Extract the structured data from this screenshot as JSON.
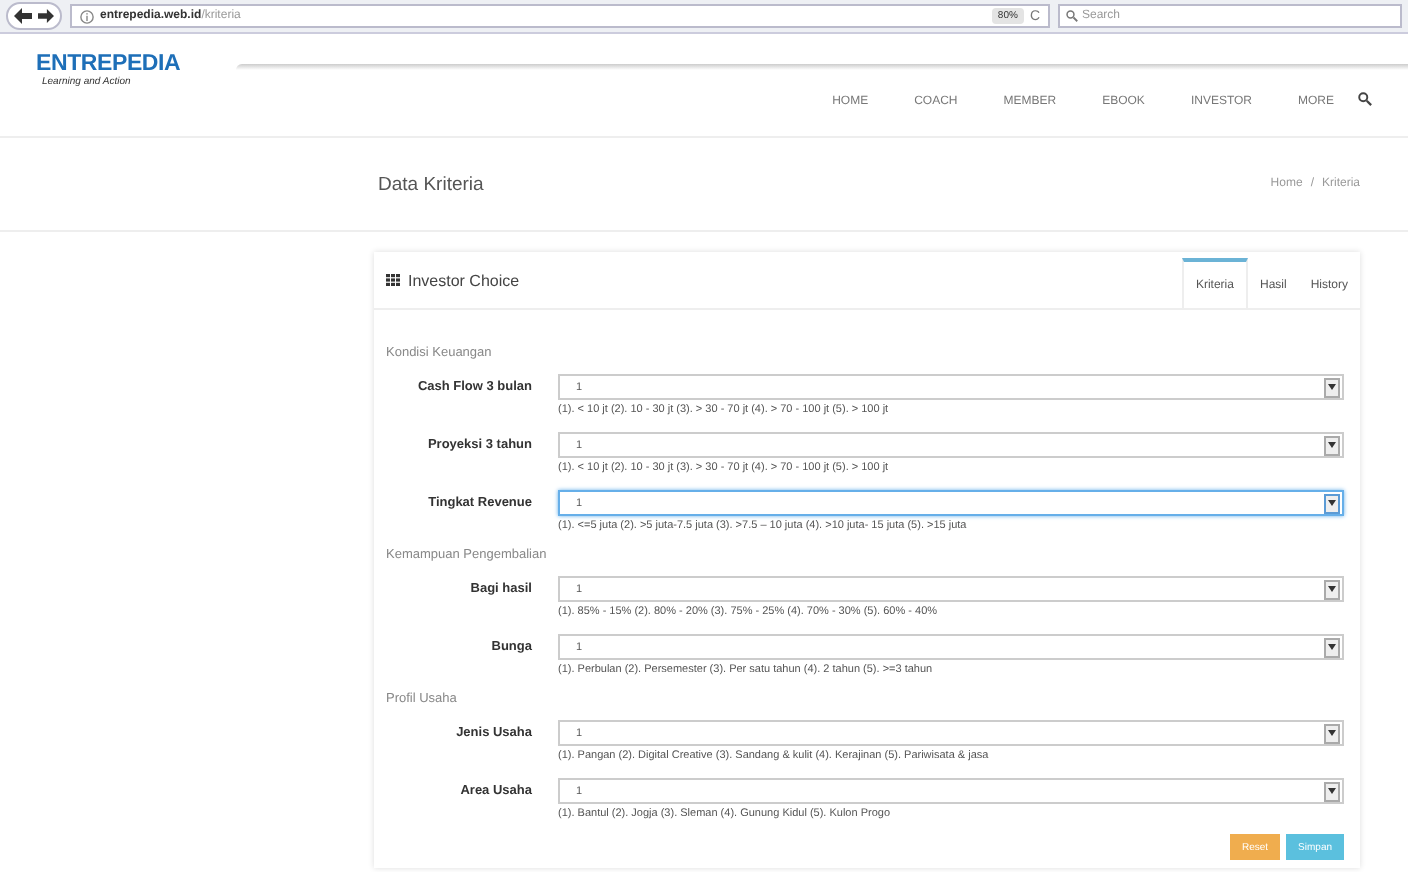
{
  "browser": {
    "url_host": "entrepedia.web.id",
    "url_path": "/kriteria",
    "zoom": "80%",
    "reload": "C",
    "search_placeholder": "Search"
  },
  "site": {
    "logo": "ENTREPEDIA",
    "tagline": "Learning and Action",
    "nav": [
      {
        "label": "HOME"
      },
      {
        "label": "COACH"
      },
      {
        "label": "MEMBER"
      },
      {
        "label": "EBOOK"
      },
      {
        "label": "INVESTOR"
      },
      {
        "label": "MORE"
      }
    ]
  },
  "page": {
    "title": "Data Kriteria",
    "breadcrumb": [
      "Home",
      "Kriteria"
    ],
    "breadcrumb_separator": "/"
  },
  "card": {
    "title": "Investor Choice",
    "tabs": [
      {
        "label": "Kriteria",
        "selected": true
      },
      {
        "label": "Hasil",
        "selected": false
      },
      {
        "label": "History",
        "selected": false
      }
    ],
    "sections": [
      {
        "title": "Kondisi Keuangan",
        "fields": [
          {
            "label": "Cash Flow 3 bulan",
            "value": "1",
            "focused": false,
            "hint": "(1). < 10 jt (2). 10 - 30 jt (3). > 30 - 70 jt (4). > 70 - 100 jt (5). > 100 jt"
          },
          {
            "label": "Proyeksi 3 tahun",
            "value": "1",
            "focused": false,
            "hint": "(1). < 10 jt (2). 10 - 30 jt (3). > 30 - 70 jt (4). > 70 - 100 jt (5). > 100 jt"
          },
          {
            "label": "Tingkat Revenue",
            "value": "1",
            "focused": true,
            "hint": "(1). <=5 juta (2). >5 juta-7.5 juta (3). >7.5 – 10 juta (4). >10 juta- 15 juta (5). >15 juta"
          }
        ]
      },
      {
        "title": "Kemampuan Pengembalian",
        "fields": [
          {
            "label": "Bagi hasil",
            "value": "1",
            "focused": false,
            "hint": "(1). 85% - 15% (2). 80% - 20% (3). 75% - 25% (4). 70% - 30% (5). 60% - 40%"
          },
          {
            "label": "Bunga",
            "value": "1",
            "focused": false,
            "hint": "(1). Perbulan (2). Persemester (3). Per satu tahun (4). 2 tahun (5). >=3 tahun"
          }
        ]
      },
      {
        "title": "Profil Usaha",
        "fields": [
          {
            "label": "Jenis Usaha",
            "value": "1",
            "focused": false,
            "hint": "(1). Pangan (2). Digital Creative (3). Sandang & kulit (4). Kerajinan (5). Pariwisata & jasa"
          },
          {
            "label": "Area Usaha",
            "value": "1",
            "focused": false,
            "hint": "(1). Bantul (2). Jogja (3). Sleman (4). Gunung Kidul (5). Kulon Progo"
          }
        ]
      }
    ],
    "buttons": [
      {
        "label": "Reset",
        "kind": "warning"
      },
      {
        "label": "Simpan",
        "kind": "info"
      }
    ]
  }
}
